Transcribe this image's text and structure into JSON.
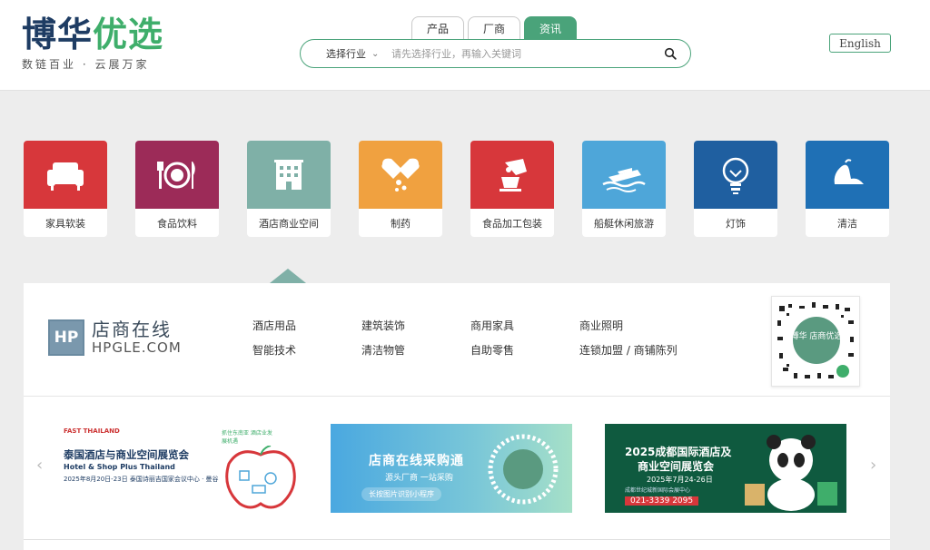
{
  "logo": {
    "main_dark": "博华",
    "main_green": "优选",
    "slogan": "数链百业 · 云展万家"
  },
  "header": {
    "tabs": [
      {
        "label": "产品"
      },
      {
        "label": "厂商"
      },
      {
        "label": "资讯"
      }
    ],
    "active_tab_index": 2,
    "language_button": "English"
  },
  "search": {
    "industry_label": "选择行业",
    "placeholder": "请先选择行业，再输入关键词",
    "value": ""
  },
  "categories": [
    {
      "label": "家具软装",
      "color": "#d7373b",
      "icon": "sofa-icon"
    },
    {
      "label": "食品饮料",
      "color": "#9c2b58",
      "icon": "plate-cutlery-icon"
    },
    {
      "label": "酒店商业空间",
      "color": "#7fb0a7",
      "icon": "hotel-building-icon"
    },
    {
      "label": "制药",
      "color": "#f0a140",
      "icon": "capsule-icon"
    },
    {
      "label": "食品加工包装",
      "color": "#d7373b",
      "icon": "mixer-icon"
    },
    {
      "label": "船艇休闲旅游",
      "color": "#4ea6d9",
      "icon": "boat-icon"
    },
    {
      "label": "灯饰",
      "color": "#1f5fa0",
      "icon": "lightbulb-icon"
    },
    {
      "label": "清洁",
      "color": "#1f70b5",
      "icon": "cleaning-glove-icon"
    }
  ],
  "active_category_index": 2,
  "panel": {
    "brand": {
      "mark": "HP",
      "name": "店商在线",
      "url": "HPGLE.COM"
    },
    "links": [
      {
        "label": "酒店用品"
      },
      {
        "label": "建筑装饰"
      },
      {
        "label": "商用家具"
      },
      {
        "label": "商业照明"
      },
      {
        "label": "智能技术"
      },
      {
        "label": "清洁物管"
      },
      {
        "label": "自助零售"
      },
      {
        "label": "连锁加盟 / 商铺陈列"
      }
    ],
    "qr_caption": "博华 店商优选"
  },
  "banners": [
    {
      "badge": "FAST THAILAND",
      "title": "泰国酒店与商业空间展览会",
      "subtitle": "Hotel & Shop Plus Thailand",
      "date": "2025年8月20日-23日",
      "venue": "泰国诗丽吉国家会议中心 · 曼谷",
      "tag": "抓住东南亚 酒店业发展机遇"
    },
    {
      "title": "店商在线采购通",
      "subtitle": "源头厂商 一站采购",
      "cta": "长按图片识别小程序"
    },
    {
      "title_line1": "2025成都国际酒店及",
      "title_line2": "商业空间展览会",
      "date": "2025年7月24-26日",
      "venue": "成都世纪城新国际会展中心",
      "phone": "021-3339 2095"
    }
  ]
}
